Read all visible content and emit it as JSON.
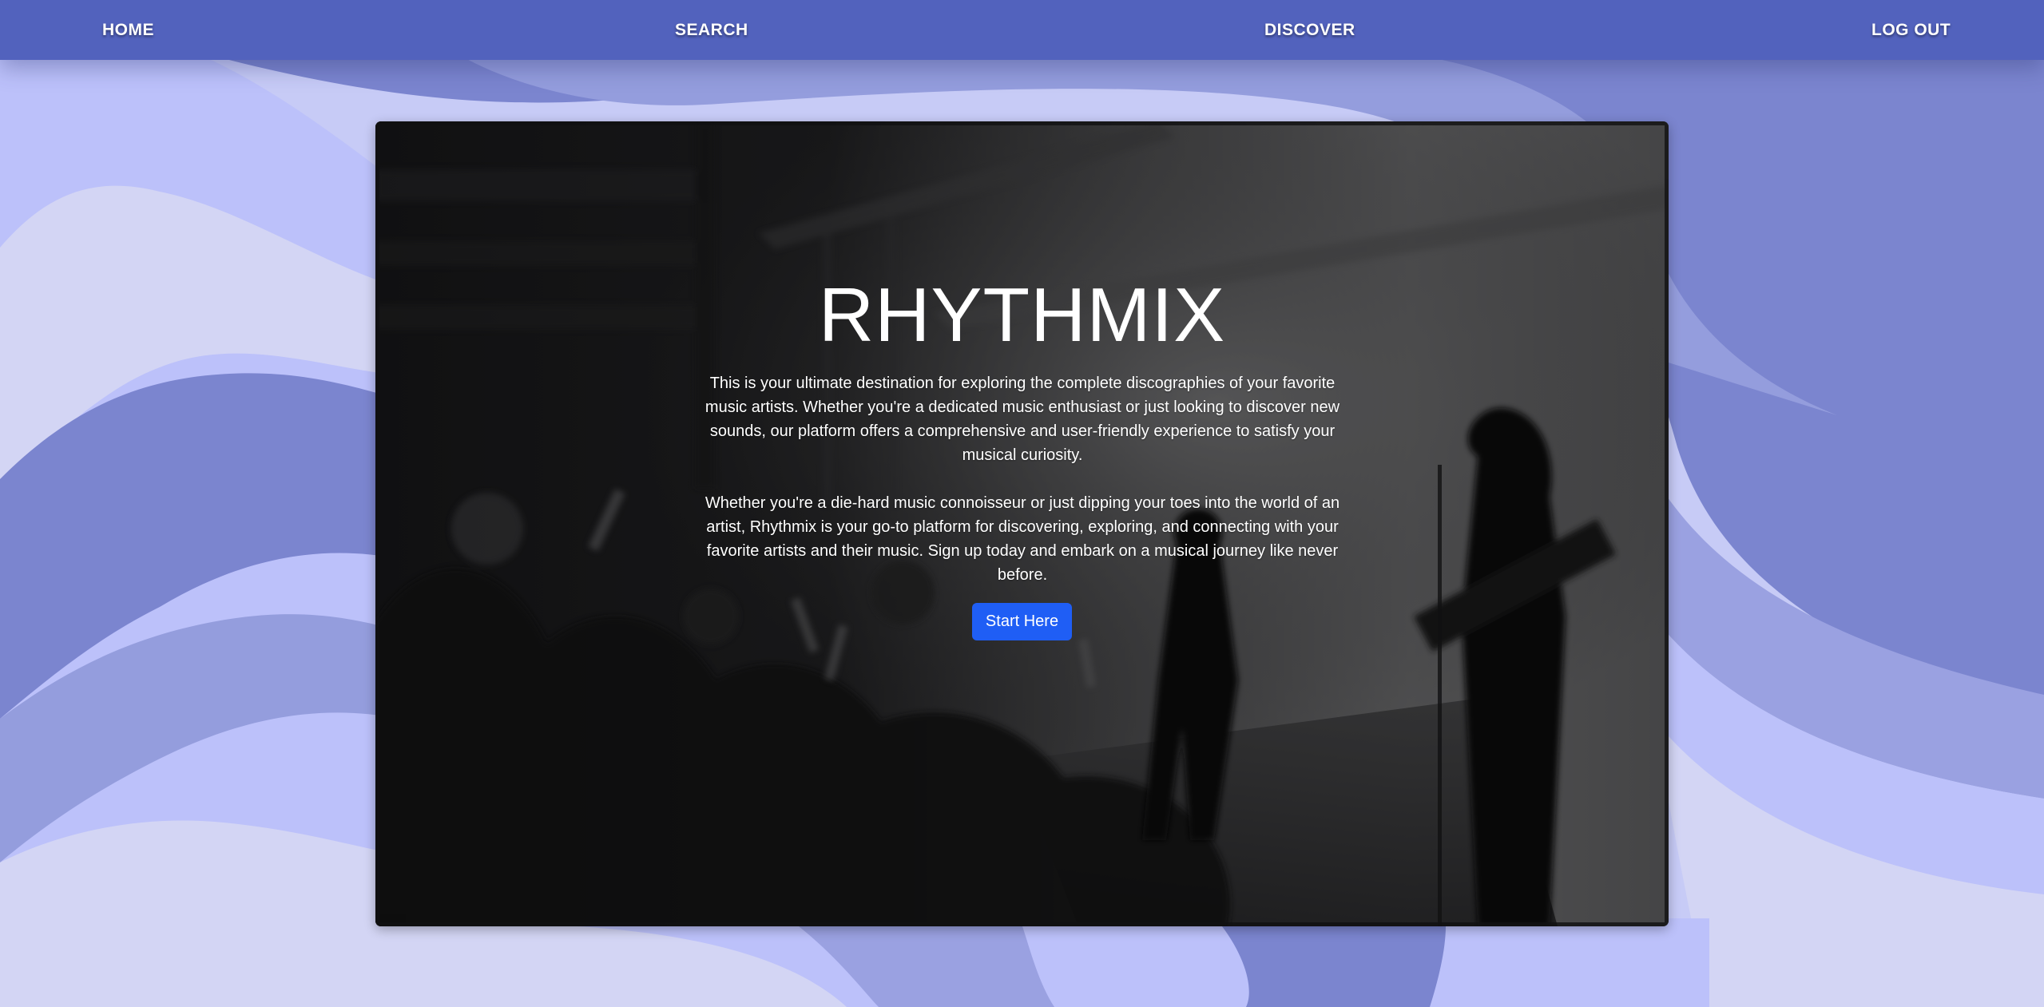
{
  "nav": {
    "home": "HOME",
    "search": "SEARCH",
    "discover": "DISCOVER",
    "logout": "LOG OUT"
  },
  "hero": {
    "title": "RHYTHMIX",
    "paragraph_1": "This is your ultimate destination for exploring the complete discographies of your favorite music artists. Whether you're a dedicated music enthusiast or just looking to discover new sounds, our platform offers a comprehensive and user-friendly experience to satisfy your musical curiosity.",
    "paragraph_2": "Whether you're a die-hard music connoisseur or just dipping your toes into the world of an artist, Rhythmix is your go-to platform for discovering, exploring, and connecting with your favorite artists and their music. Sign up today and embark on a musical journey like never before.",
    "cta_label": "Start Here",
    "background_image": "concert-crowd-photo"
  },
  "colors": {
    "navbar": "#5262bd",
    "button": "#1f5ef5",
    "wave_light": "#d3d5f4",
    "wave_mid": "#bcc1fa",
    "wave_dark": "#7b85cf"
  }
}
